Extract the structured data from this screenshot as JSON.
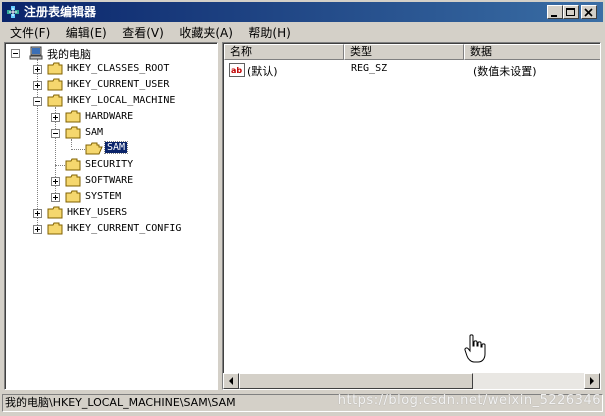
{
  "window": {
    "title": "注册表编辑器"
  },
  "menu": [
    {
      "label": "文件(F)"
    },
    {
      "label": "编辑(E)"
    },
    {
      "label": "查看(V)"
    },
    {
      "label": "收藏夹(A)"
    },
    {
      "label": "帮助(H)"
    }
  ],
  "tree": {
    "root": "我的电脑",
    "items": [
      {
        "label": "HKEY_CLASSES_ROOT"
      },
      {
        "label": "HKEY_CURRENT_USER"
      },
      {
        "label": "HKEY_LOCAL_MACHINE"
      },
      {
        "label": "HARDWARE"
      },
      {
        "label": "SAM"
      },
      {
        "label": "SAM"
      },
      {
        "label": "SECURITY"
      },
      {
        "label": "SOFTWARE"
      },
      {
        "label": "SYSTEM"
      },
      {
        "label": "HKEY_USERS"
      },
      {
        "label": "HKEY_CURRENT_CONFIG"
      }
    ]
  },
  "list": {
    "columns": [
      "名称",
      "类型",
      "数据"
    ],
    "rows": [
      {
        "name": "(默认)",
        "type": "REG_SZ",
        "data": "(数值未设置)",
        "icon": "string-value-icon"
      }
    ]
  },
  "status": {
    "path": "我的电脑\\HKEY_LOCAL_MACHINE\\SAM\\SAM"
  },
  "watermark": "https://blog.csdn.net/weixin_5226346"
}
